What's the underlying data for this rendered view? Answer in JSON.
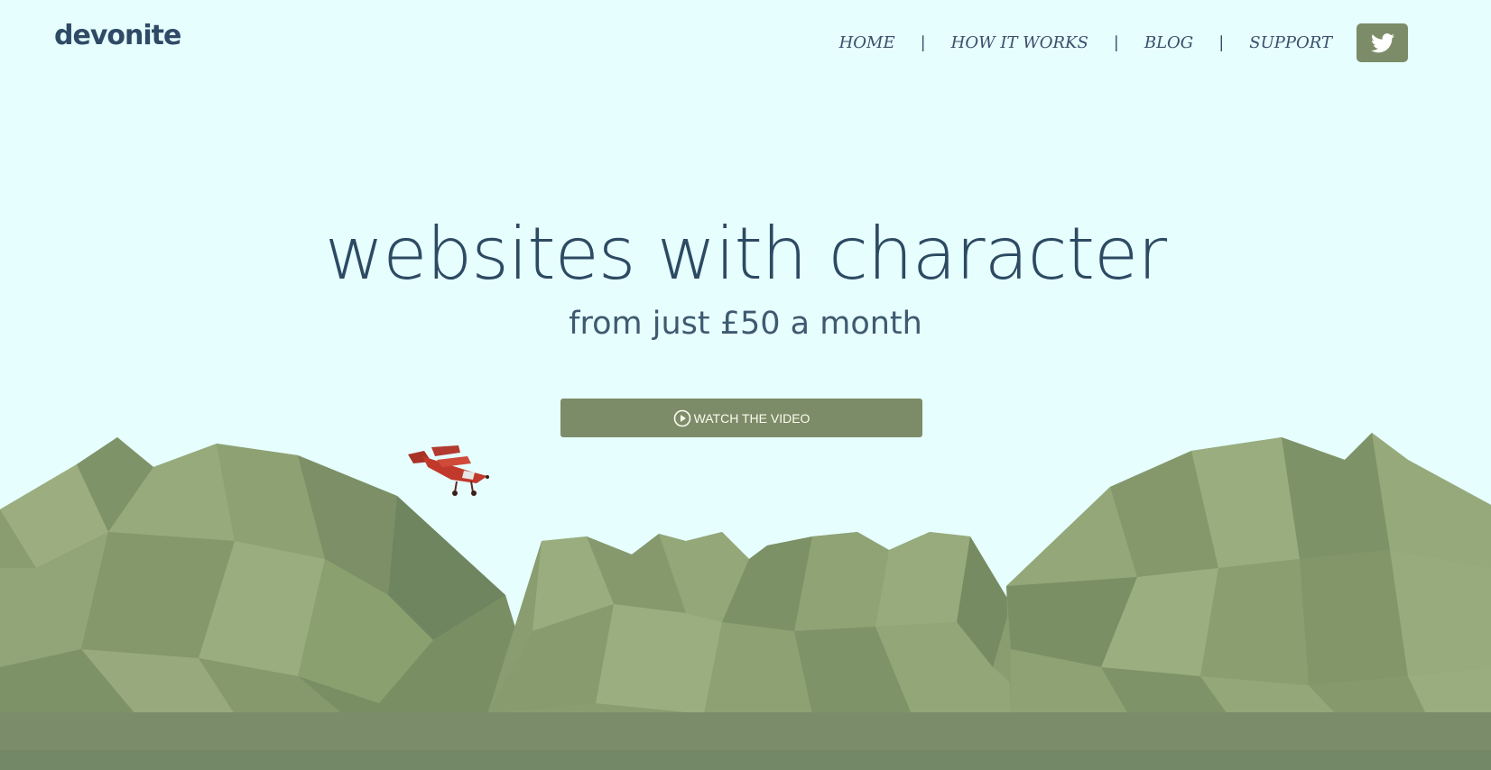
{
  "brand": {
    "logo": "devonite"
  },
  "nav": {
    "items": [
      {
        "label": "HOME"
      },
      {
        "label": "HOW IT WORKS"
      },
      {
        "label": "BLOG"
      },
      {
        "label": "SUPPORT"
      }
    ],
    "separator": "|"
  },
  "social": {
    "icon": "twitter-icon"
  },
  "hero": {
    "title": "websites with character",
    "subtitle": "from just £50 a month",
    "cta_label": "WATCH THE VIDEO",
    "cta_icon": "play-circle-icon"
  },
  "colors": {
    "background": "#e6fefe",
    "accent": "#7d8c68",
    "text_dark": "#2d4a63",
    "mountain_light": "#93a578",
    "mountain_dark": "#6b7f59",
    "plane": "#c0392b"
  }
}
